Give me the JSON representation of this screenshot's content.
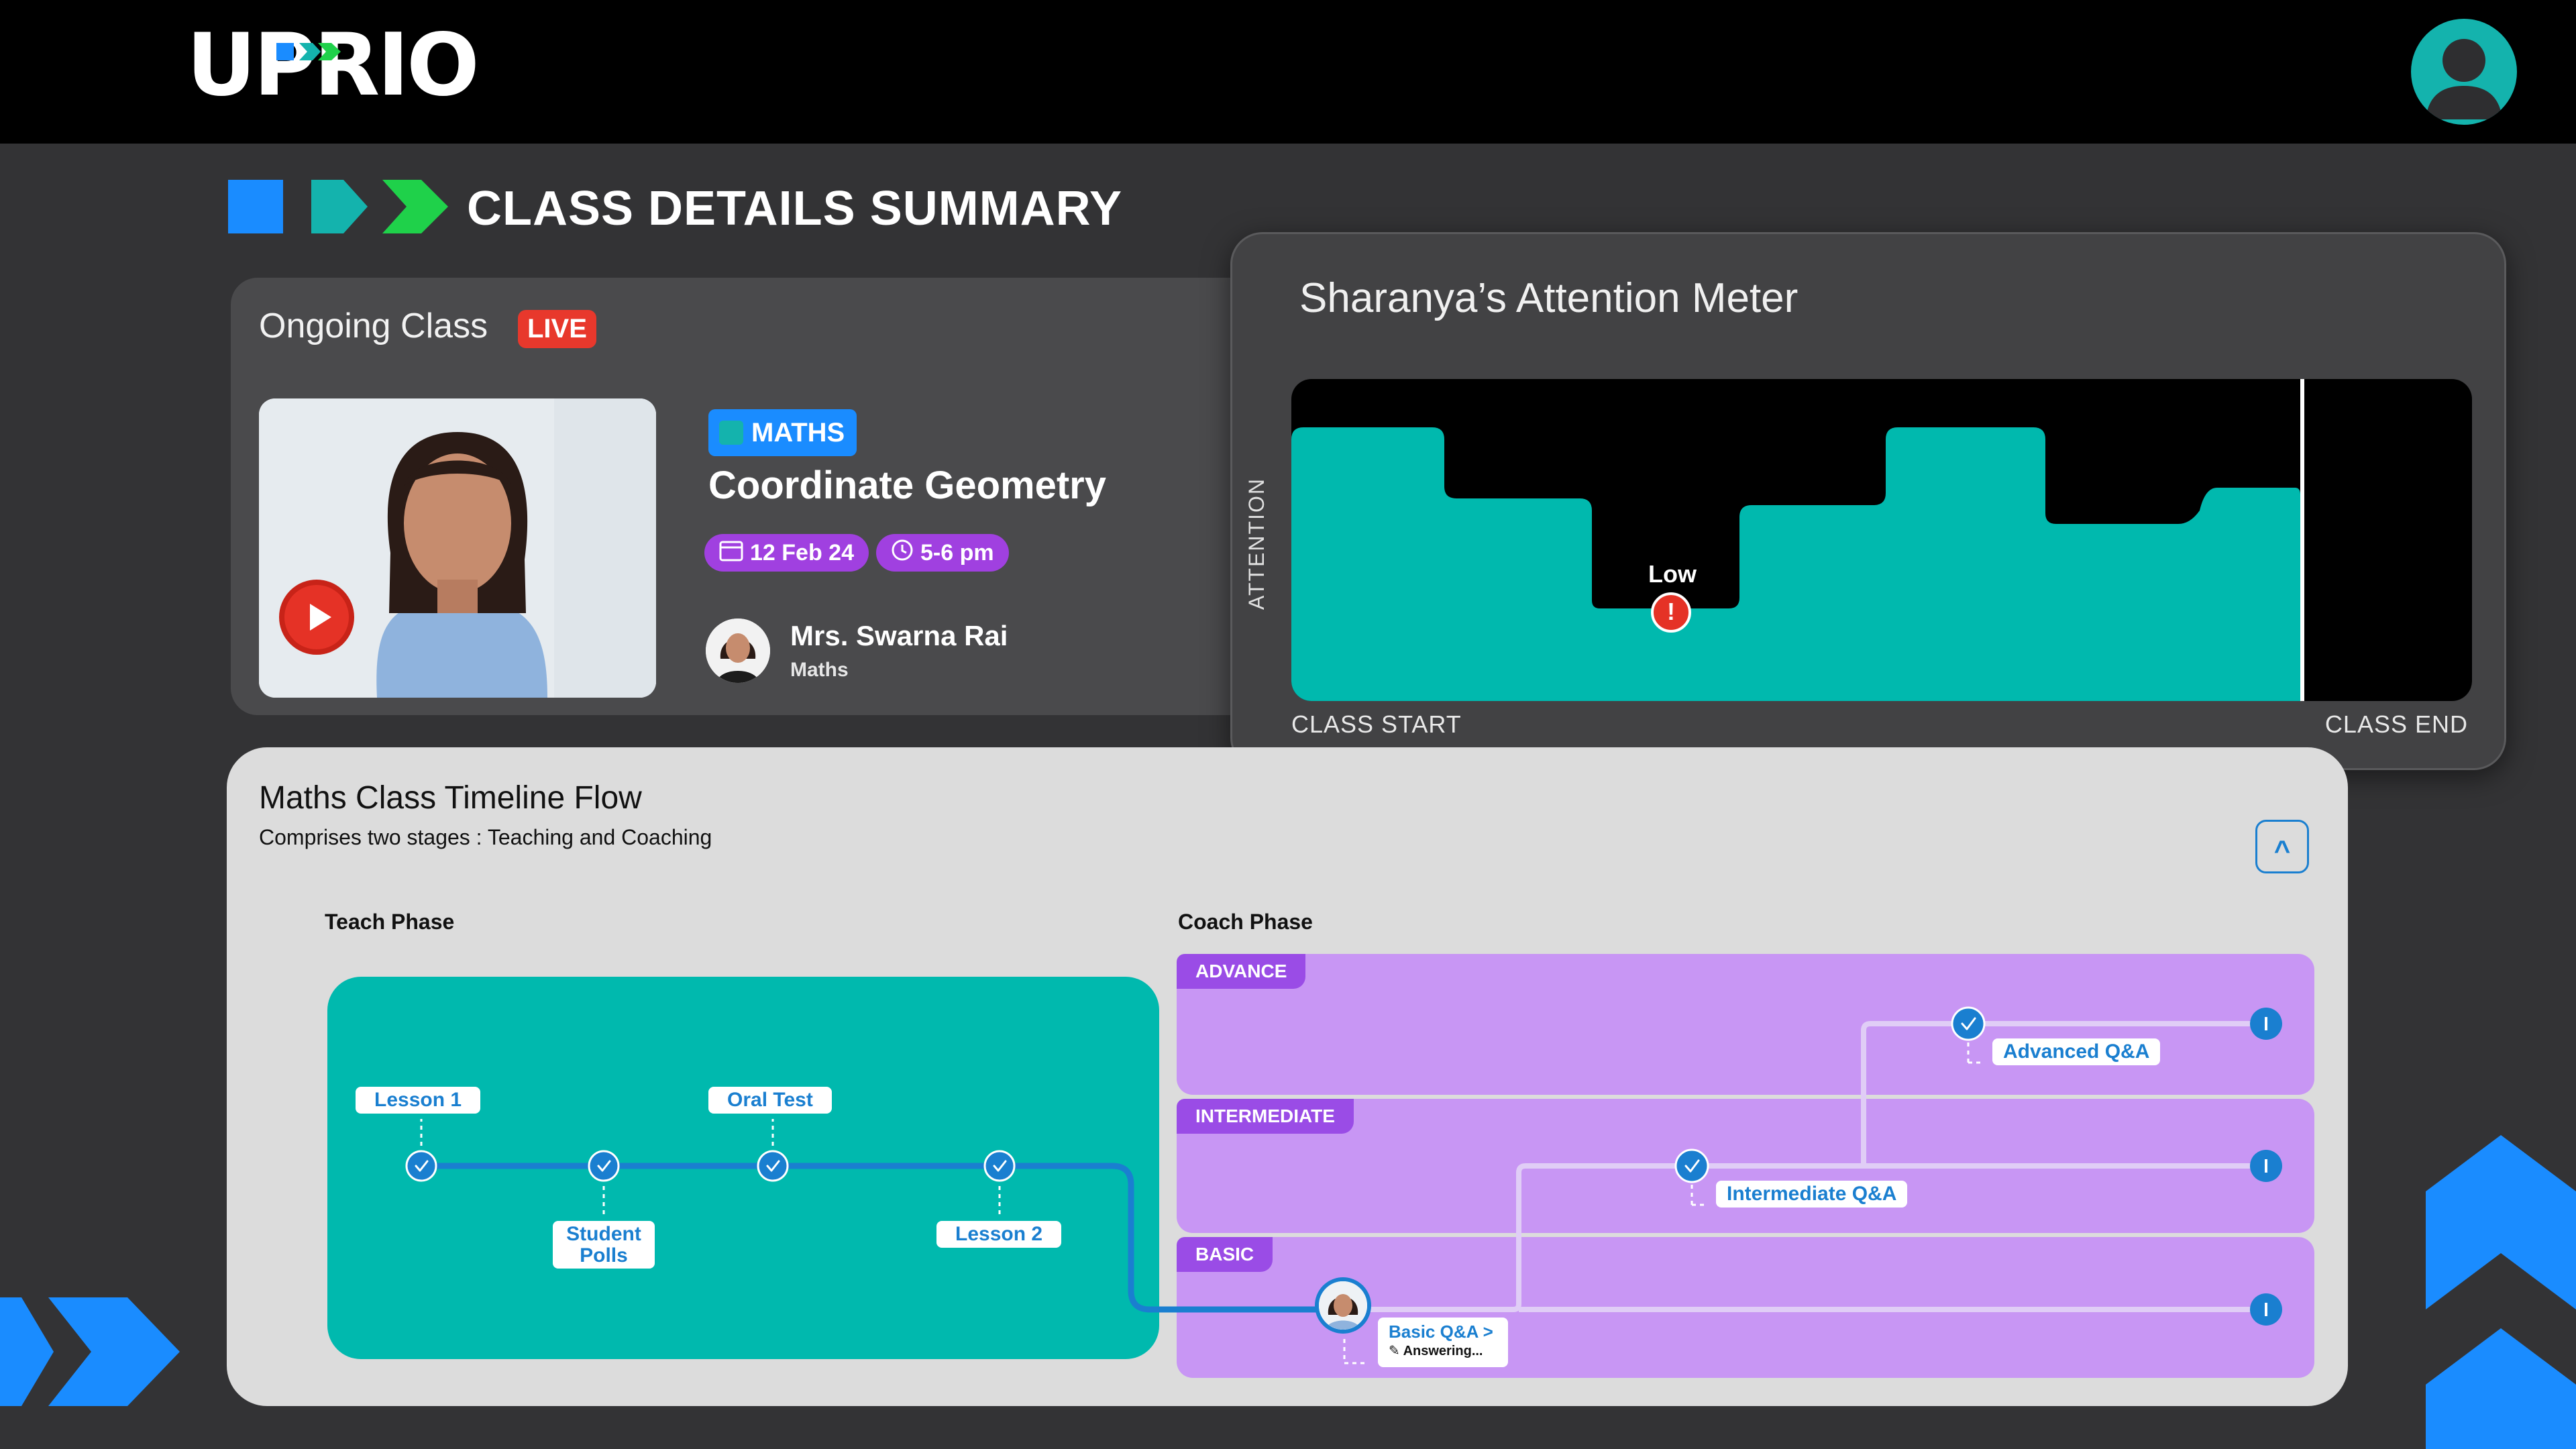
{
  "brand": {
    "logo_text": "UPRIO"
  },
  "header": {
    "avatar_icon": "user-avatar-icon"
  },
  "section": {
    "title": "CLASS DETAILS SUMMARY"
  },
  "class": {
    "heading": "Ongoing Class",
    "live_badge": "LIVE",
    "subject": "MATHS",
    "title": "Coordinate Geometry",
    "date": "12 Feb 24",
    "time": "5-6 pm",
    "teacher_name": "Mrs. Swarna Rai",
    "teacher_subject": "Maths"
  },
  "attention": {
    "title": "Sharanya’s Attention Meter",
    "y_label": "ATTENTION",
    "start_label": "CLASS START",
    "end_label": "CLASS END",
    "low_label": "Low",
    "alert_glyph": "!",
    "fill_color": "#00b9ae"
  },
  "timeline": {
    "title": "Maths Class Timeline Flow",
    "subtitle": "Comprises two stages : Teaching and Coaching",
    "collapse_glyph": "^",
    "teach_phase": "Teach Phase",
    "coach_phase": "Coach Phase",
    "lanes": {
      "advance": "ADVANCE",
      "intermediate": "INTERMEDIATE",
      "basic": "BASIC"
    },
    "teach_nodes": {
      "lesson1": "Lesson 1",
      "student_polls": "Student Polls",
      "oral_test": "Oral Test",
      "lesson2": "Lesson 2"
    },
    "coach_nodes": {
      "advanced_qa": "Advanced Q&A",
      "intermediate_qa": "Intermediate Q&A",
      "basic_qa": "Basic Q&A >",
      "basic_status": "Answering..."
    },
    "end_marker_glyph": "I",
    "colors": {
      "teach": "#00b9ae",
      "coach_lane": "#c896f4",
      "lane_tag": "#9a4ce6",
      "path": "#1a7fd0"
    }
  }
}
